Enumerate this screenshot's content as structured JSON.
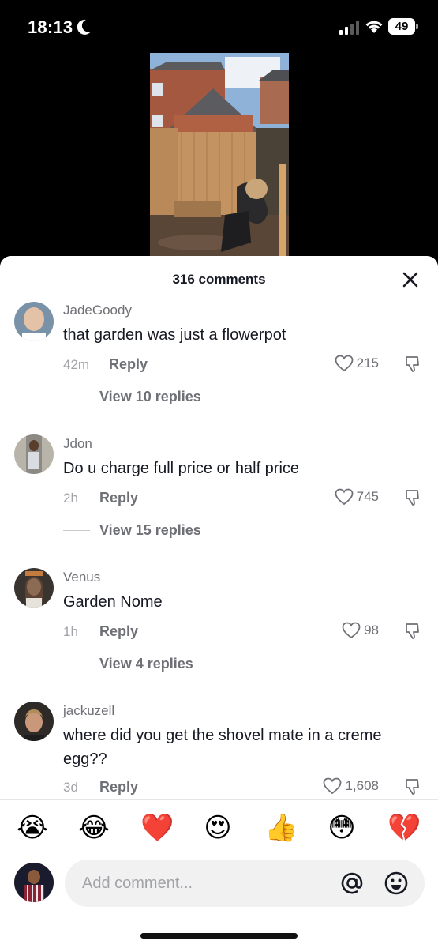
{
  "status_bar": {
    "time": "18:13",
    "battery": "49"
  },
  "sheet": {
    "title": "316 comments"
  },
  "comments": [
    {
      "username": "JadeGoody",
      "text": "that garden was just a flowerpot",
      "time": "42m",
      "reply": "Reply",
      "likes": "215",
      "view_replies": "View 10 replies"
    },
    {
      "username": "Jdon",
      "text": "Do u charge full price or half price",
      "time": "2h",
      "reply": "Reply",
      "likes": "745",
      "view_replies": "View 15 replies"
    },
    {
      "username": "Venus",
      "text": "Garden Nome",
      "time": "1h",
      "reply": "Reply",
      "likes": "98",
      "view_replies": "View 4 replies"
    },
    {
      "username": "jackuzell",
      "text": "where did you get the shovel mate in a creme egg??",
      "time": "3d",
      "reply": "Reply",
      "likes": "1,608"
    }
  ],
  "emojis": [
    "😭",
    "😂",
    "❤️",
    "😍",
    "👍",
    "😳",
    "💔"
  ],
  "input": {
    "placeholder": "Add comment..."
  },
  "colors": {
    "text": "#161823",
    "secondary": "#6f7076",
    "muted": "#a2a3a8"
  }
}
